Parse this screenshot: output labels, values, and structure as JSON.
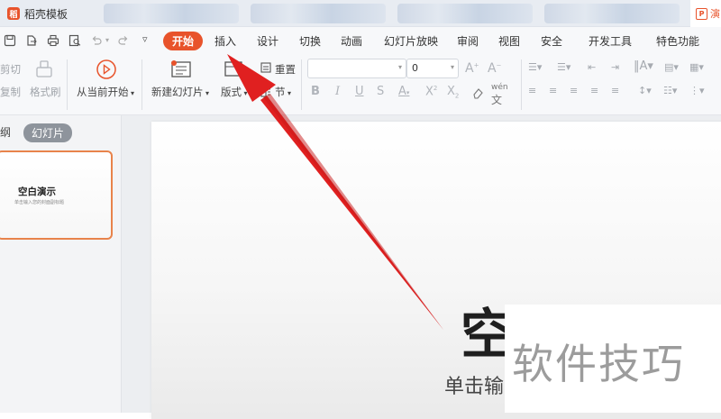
{
  "tabs": {
    "home_label": "稻壳模板",
    "active_label": "演"
  },
  "menu": {
    "items": [
      "开始",
      "插入",
      "设计",
      "切换",
      "动画",
      "幻灯片放映",
      "审阅",
      "视图",
      "安全",
      "开发工具",
      "特色功能"
    ],
    "active_index": 0
  },
  "ribbon": {
    "cut": "剪切",
    "copy": "复制",
    "format_painter": "格式刷",
    "play_from_current": "从当前开始",
    "new_slide": "新建幻灯片",
    "layout": "版式",
    "reset": "重置",
    "section": "节",
    "font_size_value": "0"
  },
  "left_panel": {
    "outline_tab": "纲",
    "slides_tab": "幻灯片",
    "thumb_title": "空白演示",
    "thumb_subtitle": "单击输入您的封面副标题"
  },
  "slide": {
    "title": "空白演示",
    "subtitle": "单击输入您的封面副标题"
  },
  "watermark": {
    "text": "软件技巧"
  },
  "colors": {
    "accent": "#e8532b",
    "arrow": "#e02020"
  }
}
